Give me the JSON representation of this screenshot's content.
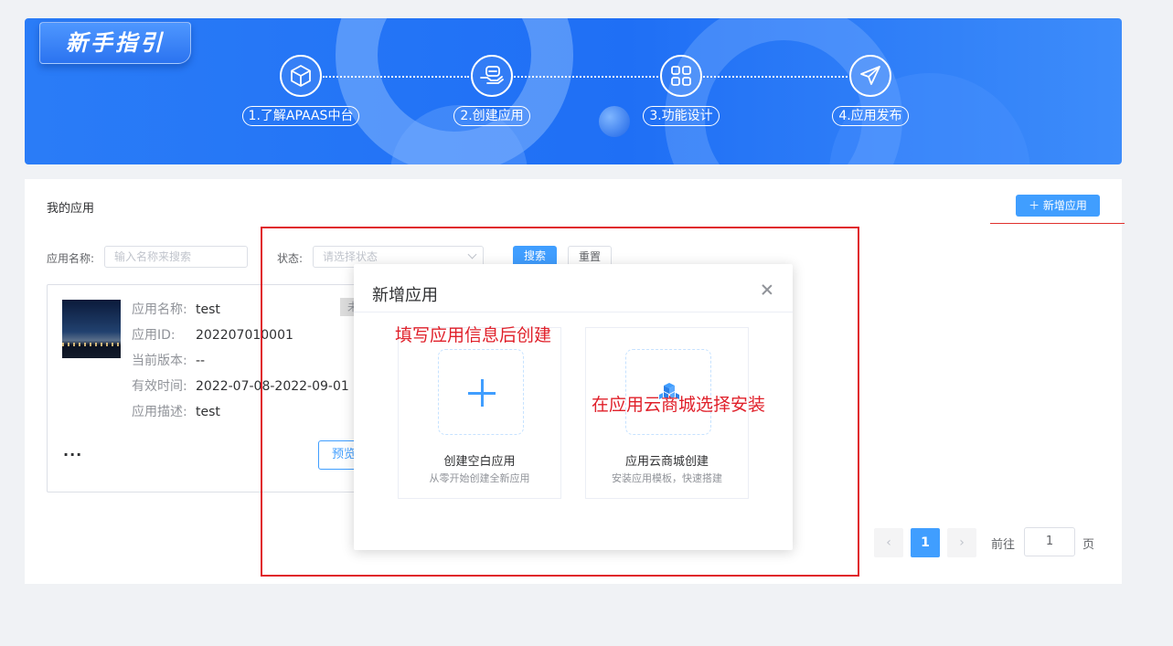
{
  "banner": {
    "title": "新手指引",
    "steps": [
      {
        "label": "1.了解APAAS中台",
        "icon": "cube-icon"
      },
      {
        "label": "2.创建应用",
        "icon": "hand-app-icon"
      },
      {
        "label": "3.功能设计",
        "icon": "grid-icon"
      },
      {
        "label": "4.应用发布",
        "icon": "send-icon"
      }
    ]
  },
  "main": {
    "title": "我的应用",
    "add_button": "＋  新增应用",
    "filter": {
      "name_label": "应用名称:",
      "name_placeholder": "输入名称来搜索",
      "status_label": "状态:",
      "status_placeholder": "请选择状态",
      "search_button": "搜索",
      "reset_button": "重置"
    },
    "card": {
      "badge": "未",
      "fields": [
        {
          "key": "应用名称:",
          "value": "test"
        },
        {
          "key": "应用ID:",
          "value": "202207010001"
        },
        {
          "key": "当前版本:",
          "value": "--"
        },
        {
          "key": "有效时间:",
          "value": "2022-07-08-2022-09-01"
        },
        {
          "key": "应用描述:",
          "value": "test"
        }
      ],
      "more": "...",
      "preview_button": "预览"
    },
    "pagination": {
      "prev": "‹",
      "current_page": "1",
      "next": "›",
      "goto_label": "前往",
      "goto_value": "1",
      "page_suffix": "页"
    }
  },
  "modal": {
    "title": "新增应用",
    "options": [
      {
        "title": "创建空白应用",
        "subtitle": "从零开始创建全新应用",
        "icon": "plus-icon"
      },
      {
        "title": "应用云商城创建",
        "subtitle": "安装应用模板，快速搭建",
        "icon": "cubes-icon"
      }
    ]
  },
  "annotations": {
    "text_blank": "填写应用信息后创建",
    "text_store": "在应用云商城选择安装",
    "color": "#e0202a"
  },
  "colors": {
    "primary": "#409eff",
    "banner": "#2a7cf7"
  }
}
